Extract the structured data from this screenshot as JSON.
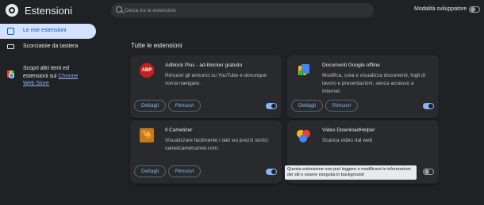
{
  "header": {
    "title": "Estensioni",
    "search_placeholder": "Cerca tra le estensioni",
    "devmode_label": "Modalità sviluppatore",
    "devmode_enabled": false
  },
  "sidebar": {
    "items": [
      {
        "label": "Le mie estensioni",
        "icon": "puzzle-icon",
        "active": true
      },
      {
        "label": "Scorciatoie da tastiera",
        "icon": "keyboard-icon",
        "active": false
      }
    ],
    "store_text": "Scopri altri temi ed estensioni sul",
    "store_link": "Chrome Web Store",
    "store_icon": "chrome-web-store-icon"
  },
  "main": {
    "section_title": "Tutte le estensioni",
    "cards": [
      {
        "name": "Adblock Plus - ad-blocker gratuito",
        "description": "Rimuovi gli annunci su YouTube e dovunque vorrai navigare.",
        "icon": "adblock-plus-icon",
        "icon_text": "ABP",
        "details_label": "Dettagli",
        "remove_label": "Rimuovi",
        "enabled": true
      },
      {
        "name": "Documenti Google offline",
        "description": "Modifica, crea e visualizza documenti, fogli di lavoro e presentazioni, senza accesso a Internet.",
        "icon": "google-docs-offline-icon",
        "details_label": "Dettagli",
        "remove_label": "Rimuovi",
        "enabled": true
      },
      {
        "name": "Il Camelizer",
        "description": "Visualizzare facilmente i dati sui prezzi storici camelcamelcamel.com.",
        "icon": "camelizer-icon",
        "details_label": "Dettagli",
        "remove_label": "Rimuovi",
        "enabled": true
      },
      {
        "name": "Video DownloadHelper",
        "description": "Scarica video dal web",
        "icon": "video-downloadhelper-icon",
        "enabled": false,
        "tooltip": "Questa estensione non può leggere e modificare le informazioni dei siti o essere eseguita in background"
      }
    ]
  },
  "colors": {
    "background": "#202124",
    "card": "#292a2d",
    "accent": "#8ab4f8",
    "active_nav": "#d3e3fd"
  }
}
